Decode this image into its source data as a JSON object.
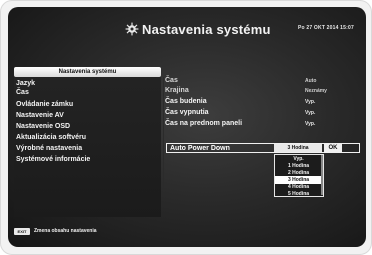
{
  "header": {
    "title": "Nastavenia systému",
    "datetime": "Po 27 OKT 2014 15:07",
    "icon": "gear-icon"
  },
  "left_menu": {
    "title": "Nastavenia systému",
    "items": [
      {
        "label": "Jazyk"
      },
      {
        "label": "Čas"
      },
      {
        "label": "Ovládanie zámku"
      },
      {
        "label": "Nastavenie AV"
      },
      {
        "label": "Nastavenie OSD"
      },
      {
        "label": "Aktualizácia softvéru"
      },
      {
        "label": "Výrobné nastavenia"
      },
      {
        "label": "Systémové informácie"
      }
    ]
  },
  "settings": {
    "rows": [
      {
        "label": "Čas",
        "value": "Auto"
      },
      {
        "label": "Krajina",
        "value": "Neznámy"
      },
      {
        "label": "Čas budenia",
        "value": "Vyp."
      },
      {
        "label": "Čas vypnutia",
        "value": "Vyp."
      },
      {
        "label": "Čas na prednom paneli",
        "value": "Vyp."
      }
    ],
    "auto_power_down": {
      "label": "Auto Power Down",
      "value": "3 Hodina",
      "ok_label": "OK",
      "options": [
        "Vyp.",
        "1 Hodina",
        "2 Hodina",
        "3 Hodina",
        "4 Hodina",
        "5 Hodina"
      ],
      "selected_option": "3 Hodina"
    }
  },
  "footer": {
    "key_label": "EXIT",
    "text": "Zmena obsahu nastavenia"
  }
}
